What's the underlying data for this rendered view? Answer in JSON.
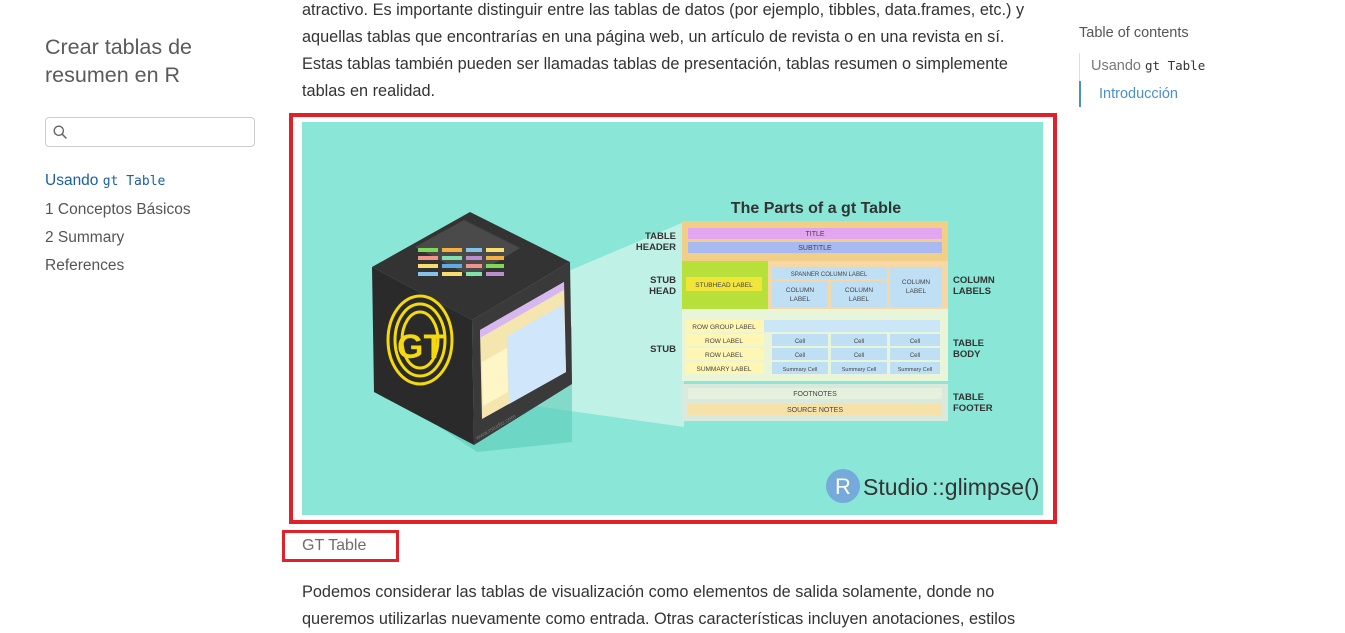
{
  "sidebar": {
    "title": "Crear tablas de resumen en R",
    "search": {
      "placeholder": "",
      "value": ""
    },
    "items": [
      {
        "label": "Usando ",
        "code": "gt Table",
        "active": true
      },
      {
        "label": "1  Conceptos Básicos"
      },
      {
        "label": "2  Summary"
      },
      {
        "label": "References"
      }
    ]
  },
  "main": {
    "intro_paragraph": "atractivo. Es importante distinguir entre las tablas de datos (por ejemplo, tibbles, data.frames, etc.) y aquellas tablas que encontrarías en una página web, un artículo de revista o en una revista en sí. Estas tablas también pueden ser llamadas tablas de presentación, tablas resumen o simplemente tablas en realidad.",
    "figure": {
      "title": "The Parts of a gt Table",
      "logo_letters": "GT",
      "watermark": "www.rstudio.com",
      "brand_r": "R",
      "brand_studio": "Studio",
      "brand_suffix": "::glimpse()",
      "section_labels": {
        "table_header": [
          "TABLE",
          "HEADER"
        ],
        "stub_head": [
          "STUB",
          "HEAD"
        ],
        "stub": "STUB",
        "column_labels": [
          "COLUMN",
          "LABELS"
        ],
        "table_body": [
          "TABLE",
          "BODY"
        ],
        "table_footer": [
          "TABLE",
          "FOOTER"
        ]
      },
      "parts": {
        "title": "TITLE",
        "subtitle": "SUBTITLE",
        "stubhead_label": "STUBHEAD LABEL",
        "spanner_column_label": "SPANNER COLUMN LABEL",
        "column_label": [
          "COLUMN",
          "LABEL"
        ],
        "row_group_label": "ROW GROUP LABEL",
        "row_label": "ROW LABEL",
        "summary_label": "SUMMARY LABEL",
        "cell": "Cell",
        "summary_cell": "Summary Cell",
        "footnotes": "FOOTNOTES",
        "source_notes": "SOURCE NOTES"
      },
      "colors": {
        "background": "#8ae6d6",
        "header_band": "#f2cf86",
        "stub_band": "#b7e03a",
        "column_band": "#f6d7a7",
        "body_blue": "#bfdff5",
        "footer_band": "#d9e9dc",
        "highlight_border": "#e0212a"
      }
    },
    "figure_caption": "GT Table",
    "body_paragraph": "Podemos considerar las tablas de visualización como elementos de salida solamente, donde no queremos utilizarlas nuevamente como entrada. Otras características incluyen anotaciones, estilos"
  },
  "toc": {
    "title": "Table of contents",
    "items": [
      {
        "label": "Usando ",
        "code": "Table",
        "code_prefix": "gt"
      },
      {
        "label": "Introducción",
        "active": true
      }
    ]
  }
}
